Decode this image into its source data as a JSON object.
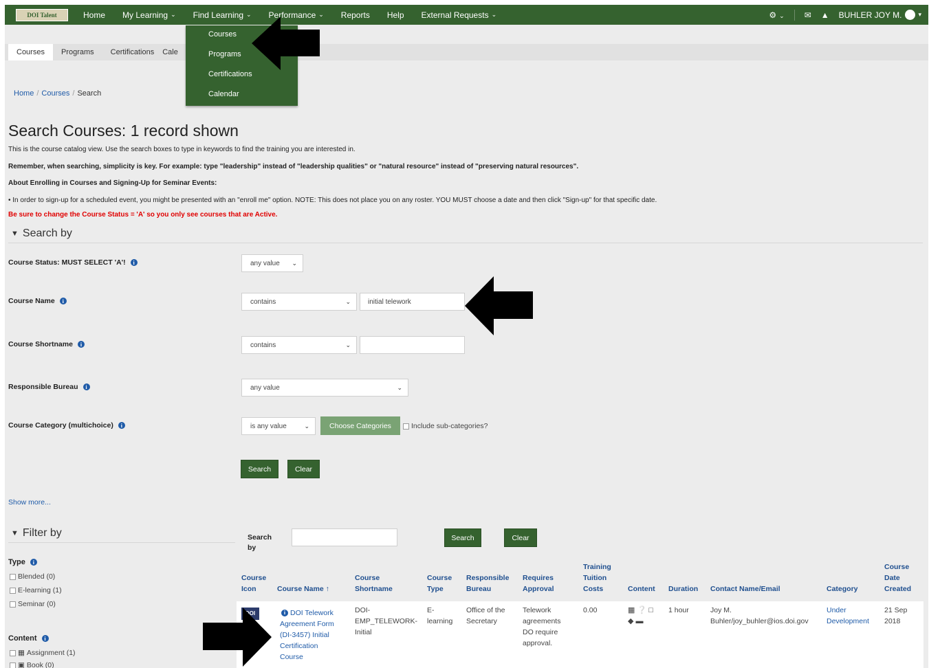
{
  "nav": {
    "logo": "DOI Talent",
    "items": [
      "Home",
      "My Learning",
      "Find Learning",
      "Performance",
      "Reports",
      "Help",
      "External Requests"
    ],
    "user": "BUHLER JOY M."
  },
  "tabs": [
    "Courses",
    "Programs",
    "Certifications",
    "Cale"
  ],
  "dropdown": [
    "Courses",
    "Programs",
    "Certifications",
    "Calendar"
  ],
  "breadcrumb": [
    "Home",
    "Courses",
    "Search"
  ],
  "page_title": "Search Courses: 1 record shown",
  "info": {
    "line1": "This is the course catalog view.  Use the search boxes to type in keywords to find the training you are interested in.",
    "line2": "Remember, when searching, simplicity is key.  For example: type \"leadership\" instead of \"leadership qualities\" or \"natural resource\" instead of \"preserving natural resources\".",
    "line3": "About Enrolling in Courses and Signing-Up for Seminar Events:",
    "line4": "•  In order to sign-up for a scheduled event, you might be presented with an \"enroll me\" option. NOTE:  This does not place you on any roster.  YOU MUST choose a date and then click \"Sign-up\" for that specific date.",
    "line5": "Be sure to change the Course Status = 'A' so you only see courses that are Active."
  },
  "search_by": {
    "heading": "Search by",
    "course_status": {
      "label": "Course Status: MUST SELECT 'A'!",
      "value": "any value"
    },
    "course_name": {
      "label": "Course Name",
      "operator": "contains",
      "value": "initial telework"
    },
    "course_shortname": {
      "label": "Course Shortname",
      "operator": "contains",
      "value": ""
    },
    "responsible_bureau": {
      "label": "Responsible Bureau",
      "value": "any value"
    },
    "course_category": {
      "label": "Course Category (multichoice)",
      "value": "is any value",
      "choose_button": "Choose Categories",
      "subcat_label": "Include sub-categories?"
    },
    "search_button": "Search",
    "clear_button": "Clear",
    "show_more": "Show more..."
  },
  "filter_by": {
    "heading": "Filter by",
    "type_title": "Type",
    "types": [
      "Blended (0)",
      "E-learning (1)",
      "Seminar (0)"
    ],
    "content_title": "Content",
    "contents": [
      "Assignment (1)",
      "Book (0)"
    ]
  },
  "table_search": {
    "label_line1": "Search",
    "label_line2": "by",
    "value": "",
    "search_button": "Search",
    "clear_button": "Clear"
  },
  "table": {
    "headers": {
      "icon": [
        "Course",
        "Icon"
      ],
      "name": [
        "Course Name ↑"
      ],
      "shortname": [
        "Course",
        "Shortname"
      ],
      "type": [
        "Course",
        "Type"
      ],
      "bureau": [
        "Responsible",
        "Bureau"
      ],
      "approval": [
        "Requires",
        "Approval"
      ],
      "costs": [
        "Training",
        "Tuition",
        "Costs"
      ],
      "content": [
        "Content"
      ],
      "duration": [
        "Duration"
      ],
      "contact": [
        "Contact Name/Email"
      ],
      "category": [
        "Category"
      ],
      "created": [
        "Course",
        "Date",
        "Created"
      ]
    },
    "row": {
      "icon": "DOI",
      "name": [
        "DOI Telework",
        "Agreement Form",
        "(DI-3457) Initial",
        "Certification",
        "Course"
      ],
      "shortname": [
        "DOI-",
        "EMP_TELEWORK-",
        "Initial"
      ],
      "type": [
        "E-",
        "learning"
      ],
      "bureau": [
        "Office of the",
        "Secretary"
      ],
      "approval": [
        "Telework",
        "agreements",
        "DO require",
        "approval."
      ],
      "costs": "0.00",
      "duration": "1 hour",
      "contact": [
        "Joy M.",
        "Buhler/joy_buhler@ios.doi.gov"
      ],
      "category": [
        "Under",
        "Development"
      ],
      "created": [
        "21 Sep",
        "2018"
      ]
    }
  },
  "colors": {
    "brand_green": "#35622f",
    "link_blue": "#1f5ba8",
    "warning_red": "#e00000"
  }
}
